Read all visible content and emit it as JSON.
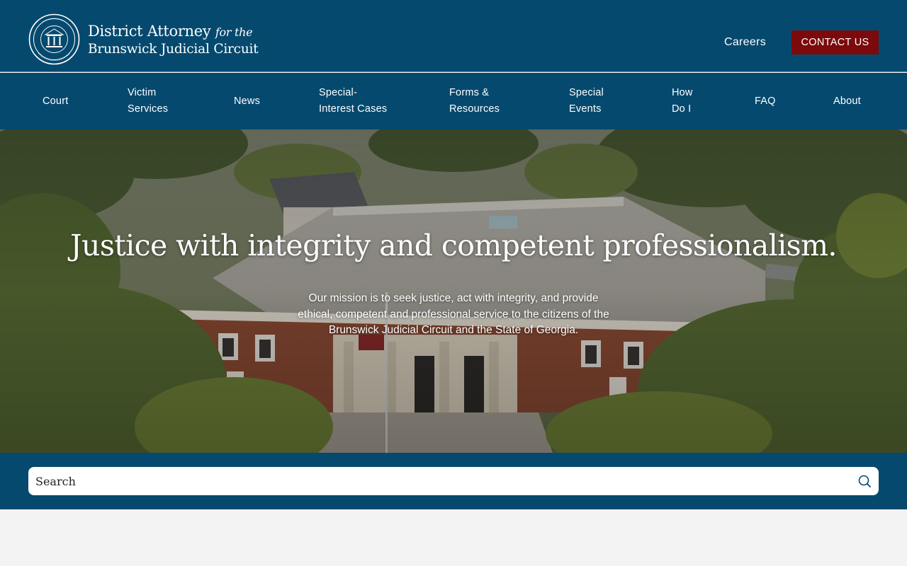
{
  "brand": {
    "title_main": "District Attorney",
    "title_for": "for the",
    "subtitle": "Brunswick Judicial Circuit",
    "seal_icon": "georgia-state-seal-icon"
  },
  "header": {
    "careers_label": "Careers",
    "contact_label": "CONTACT US",
    "contact_color": "#7c0a0c",
    "background_color": "#05496e"
  },
  "nav": {
    "court": {
      "line1": "Court"
    },
    "victim": {
      "line1": "Victim",
      "line2": "Services"
    },
    "news": {
      "line1": "News"
    },
    "special_interest": {
      "line1": "Special-",
      "line2": "Interest Cases"
    },
    "forms": {
      "line1": "Forms &",
      "line2": "Resources"
    },
    "special_events": {
      "line1": "Special",
      "line2": "Events"
    },
    "how": {
      "line1": "How",
      "line2": "Do I"
    },
    "faq": {
      "line1": "FAQ"
    },
    "about": {
      "line1": "About"
    }
  },
  "hero": {
    "title": "Justice with integrity and competent professionalism.",
    "mission": "Our mission is to seek justice, act with integrity, and provide ethical, competent and professional service to the citizens of the Brunswick Judicial Circuit and the State of Georgia."
  },
  "search": {
    "placeholder": "Search",
    "icon": "search-icon"
  }
}
